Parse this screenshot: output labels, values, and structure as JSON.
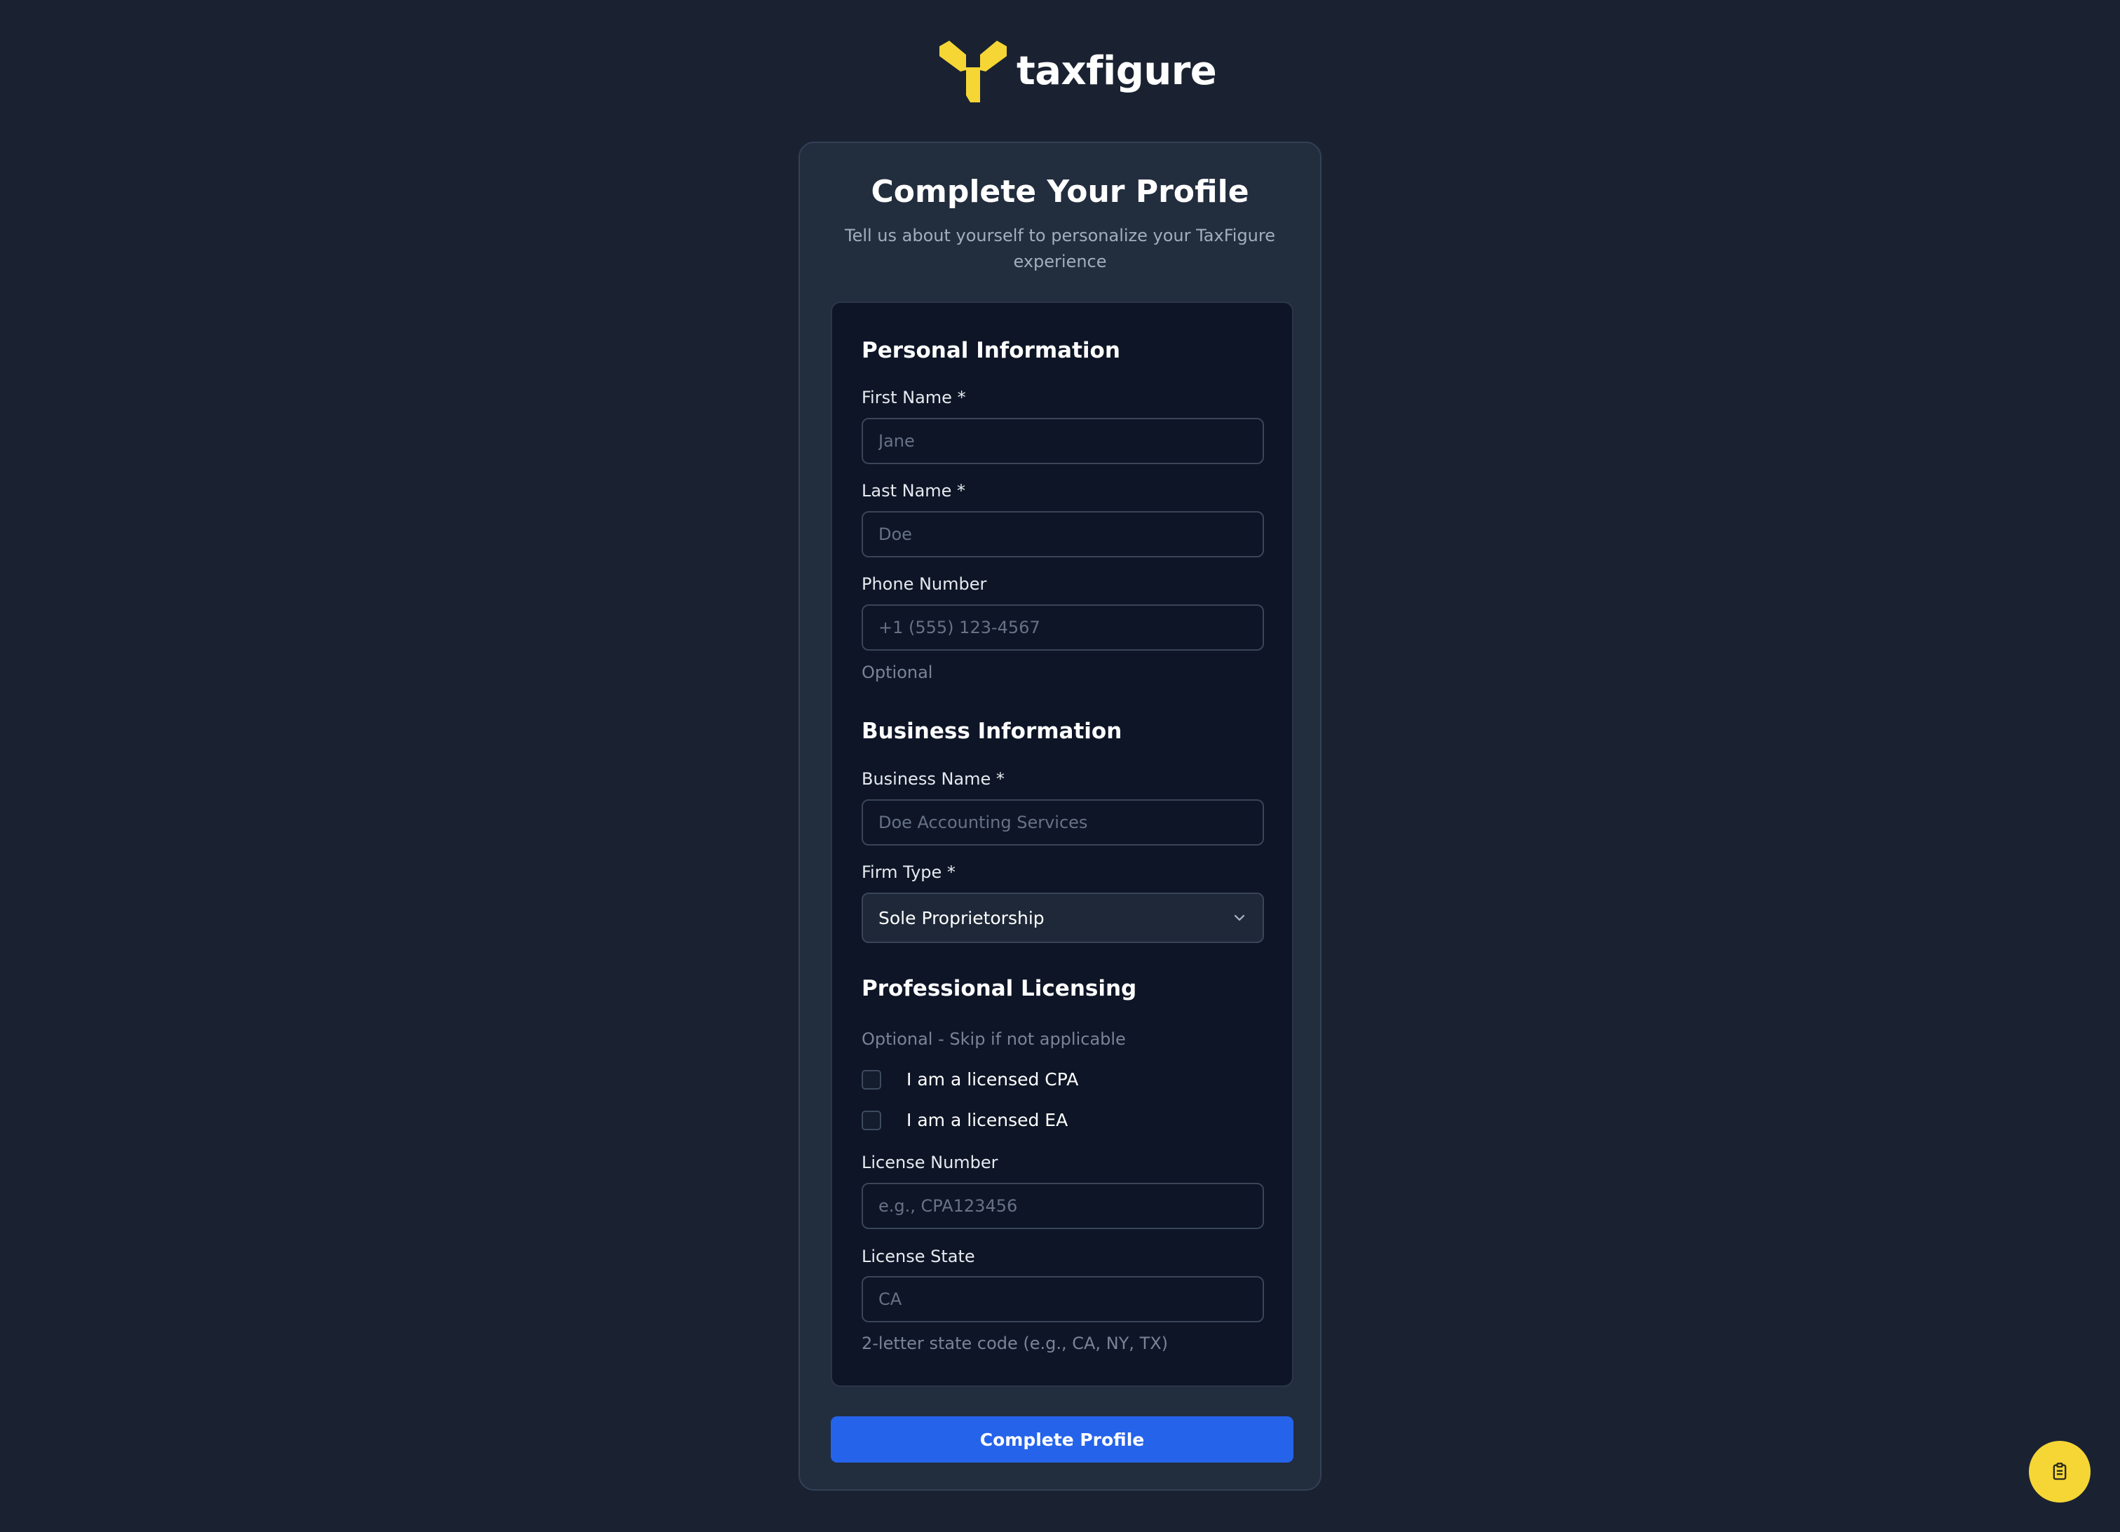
{
  "brand": {
    "name": "taxfigure",
    "accent": "#f5d635"
  },
  "header": {
    "title": "Complete Your Profile",
    "subtitle": "Tell us about yourself to personalize your TaxFigure experience"
  },
  "personal": {
    "heading": "Personal Information",
    "first_name": {
      "label": "First Name *",
      "placeholder": "Jane",
      "value": ""
    },
    "last_name": {
      "label": "Last Name *",
      "placeholder": "Doe",
      "value": ""
    },
    "phone": {
      "label": "Phone Number",
      "placeholder": "+1 (555) 123-4567",
      "value": "",
      "hint": "Optional"
    }
  },
  "business": {
    "heading": "Business Information",
    "business_name": {
      "label": "Business Name *",
      "placeholder": "Doe Accounting Services",
      "value": ""
    },
    "firm_type": {
      "label": "Firm Type *",
      "selected": "Sole Proprietorship"
    }
  },
  "licensing": {
    "heading": "Professional Licensing",
    "note": "Optional - Skip if not applicable",
    "cpa": {
      "label": "I am a licensed CPA",
      "checked": false
    },
    "ea": {
      "label": "I am a licensed EA",
      "checked": false
    },
    "license_number": {
      "label": "License Number",
      "placeholder": "e.g., CPA123456",
      "value": ""
    },
    "license_state": {
      "label": "License State",
      "placeholder": "CA",
      "value": "",
      "hint": "2-letter state code (e.g., CA, NY, TX)"
    }
  },
  "actions": {
    "submit_label": "Complete Profile",
    "submit_color": "#2563eb"
  },
  "fab": {
    "icon": "clipboard-icon"
  }
}
